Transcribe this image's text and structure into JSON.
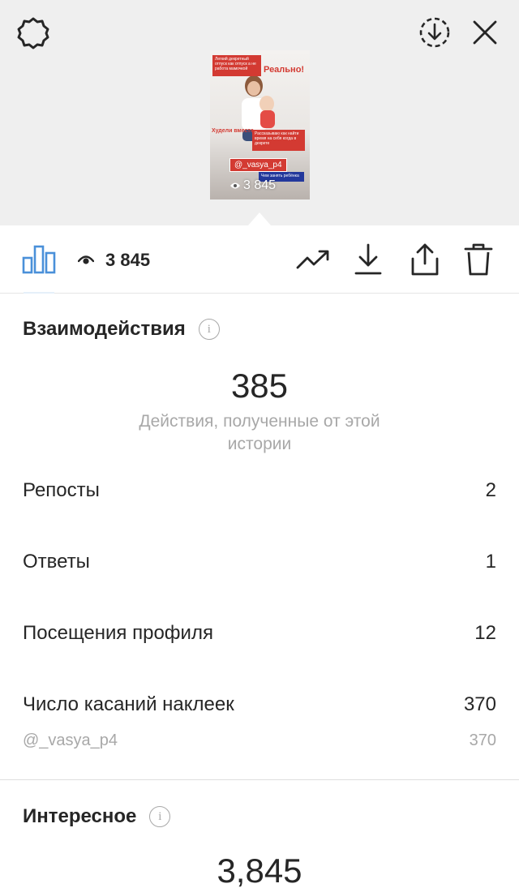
{
  "header": {
    "settings_icon": "gear-icon",
    "save_icon": "download-circle-icon",
    "close_icon": "close-icon"
  },
  "story_preview": {
    "headline_text": "Легкий декретный отпуск как отпуск а не работа мамочкой",
    "accent_word": "Реально!",
    "side_caption": "Худели вместе",
    "info_text": "Рассказываю как найти время на себя когда в декрете",
    "handle": "@_vasya_p4",
    "footer_text": "Чем занять ребёнка",
    "views": "3 845"
  },
  "toolbar": {
    "insights_icon": "bar-chart-icon",
    "view_count": "3 845",
    "trend_icon": "trending-icon",
    "download_icon": "download-icon",
    "share_icon": "share-icon",
    "delete_icon": "trash-icon"
  },
  "interactions": {
    "title": "Взаимодействия",
    "total": "385",
    "caption": "Действия, полученные от этой истории",
    "rows": [
      {
        "label": "Репосты",
        "value": "2"
      },
      {
        "label": "Ответы",
        "value": "1"
      },
      {
        "label": "Посещения профиля",
        "value": "12"
      },
      {
        "label": "Число касаний наклеек",
        "value": "370"
      }
    ],
    "sticker": {
      "label": "@_vasya_p4",
      "value": "370"
    }
  },
  "discovery": {
    "title": "Интересное",
    "total": "3,845"
  },
  "colors": {
    "accent_blue": "#4a90d9",
    "text": "#262626",
    "secondary": "#a8a8a8",
    "top_bg": "#efefef"
  }
}
